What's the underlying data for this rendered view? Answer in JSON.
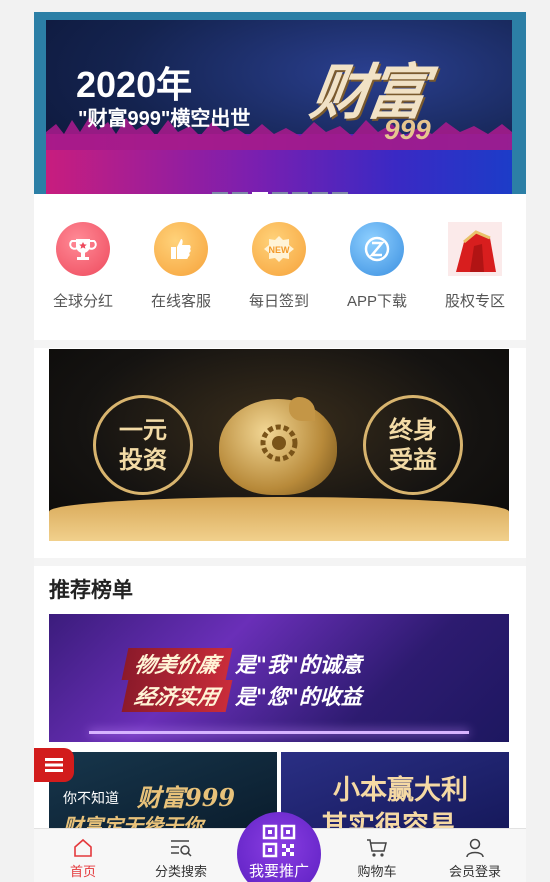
{
  "banner": {
    "year": "2020年",
    "subtitle": "\"财富999\"横空出世",
    "logo_text": "财富",
    "logo_number": "999",
    "dots": [
      false,
      false,
      true,
      false,
      false,
      false,
      false
    ]
  },
  "icons": [
    {
      "label": "全球分红",
      "icon": "trophy-icon",
      "color": "#f25b6c"
    },
    {
      "label": "在线客服",
      "icon": "thumbs-up-icon",
      "color": "#f8a640"
    },
    {
      "label": "每日签到",
      "icon": "new-badge-icon",
      "color": "#f8a640"
    },
    {
      "label": "APP下载",
      "icon": "app-download-icon",
      "color": "#3a9be8"
    },
    {
      "label": "股权专区",
      "icon": "equity-icon",
      "color": "#d81e1e"
    }
  ],
  "promo": {
    "left_ring": [
      "一元",
      "投资"
    ],
    "right_ring": [
      "终身",
      "受益"
    ]
  },
  "recommend": {
    "title": "推荐榜单",
    "banner_lines": [
      {
        "tag": "物美价廉",
        "text": "是\"我\"的诚意"
      },
      {
        "tag": "经济实用",
        "text": "是\"您\"的收益"
      }
    ],
    "tile_a": {
      "line1": "你不知道",
      "line2": "财富999",
      "line3": "财富定无缘于你"
    },
    "tile_b": {
      "line1": "小本赢大利",
      "line2": "其实很容易"
    }
  },
  "tabbar": {
    "tabs": [
      {
        "label": "首页",
        "icon": "home-icon",
        "active": true
      },
      {
        "label": "分类搜索",
        "icon": "category-search-icon",
        "active": false
      },
      {
        "label": "购物车",
        "icon": "cart-icon",
        "active": false
      },
      {
        "label": "会员登录",
        "icon": "user-icon",
        "active": false
      }
    ],
    "center_label": "我要推广",
    "center_icon": "qr-code-icon"
  },
  "colors": {
    "accent_red": "#e4393c",
    "menu_red": "#d21c1c",
    "promote_purple": "#6a28cf"
  }
}
